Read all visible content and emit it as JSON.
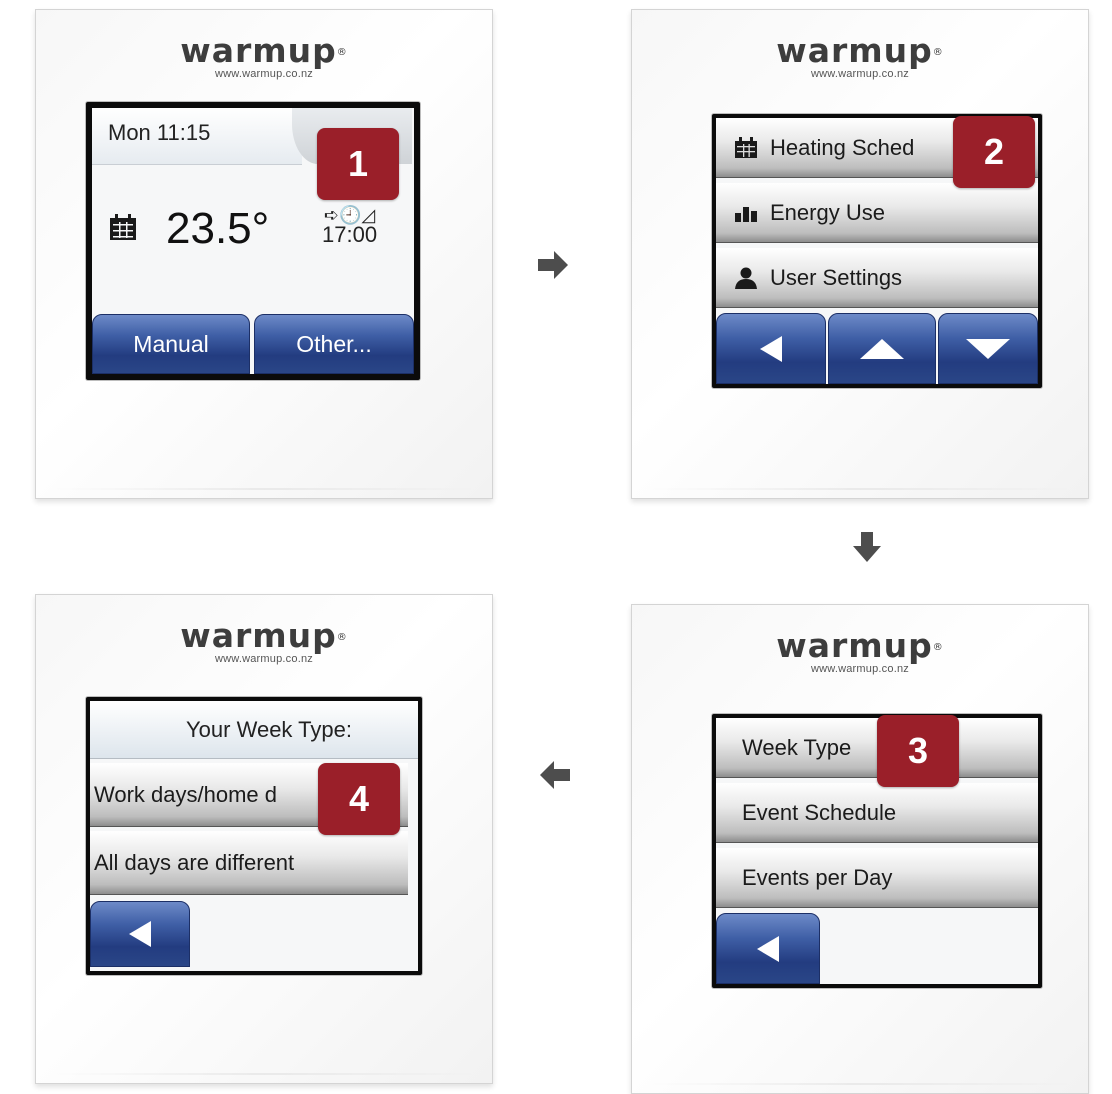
{
  "brand": {
    "name": "warmup",
    "trademark": "®",
    "url": "www.warmup.co.nz"
  },
  "colors": {
    "badge": "#9a1f29",
    "button_blue": "#2a4687",
    "arrow": "#4d4d4d"
  },
  "steps": [
    {
      "number": "1",
      "screen": "home",
      "time": "Mon 11:15",
      "temperature": "23.5°",
      "schedule_icons": "➪🕘◿",
      "next_event_time": "17:00",
      "buttons": [
        "Manual",
        "Other..."
      ]
    },
    {
      "number": "2",
      "screen": "menu",
      "items": [
        {
          "label": "Heating Sched",
          "icon": "calendar-icon"
        },
        {
          "label": "Energy Use",
          "icon": "bar-chart-icon"
        },
        {
          "label": "User Settings",
          "icon": "user-icon"
        }
      ],
      "nav": [
        "back-icon",
        "up-icon",
        "down-icon"
      ]
    },
    {
      "number": "3",
      "screen": "heating-schedule",
      "items": [
        "Week Type",
        "Event Schedule",
        "Events per Day"
      ],
      "nav": [
        "back-icon"
      ]
    },
    {
      "number": "4",
      "screen": "week-type",
      "title": "Your Week Type:",
      "items": [
        "Work days/home d",
        "All days are different"
      ],
      "nav": [
        "back-icon"
      ]
    }
  ],
  "flow_arrows": [
    "right",
    "down",
    "left"
  ]
}
